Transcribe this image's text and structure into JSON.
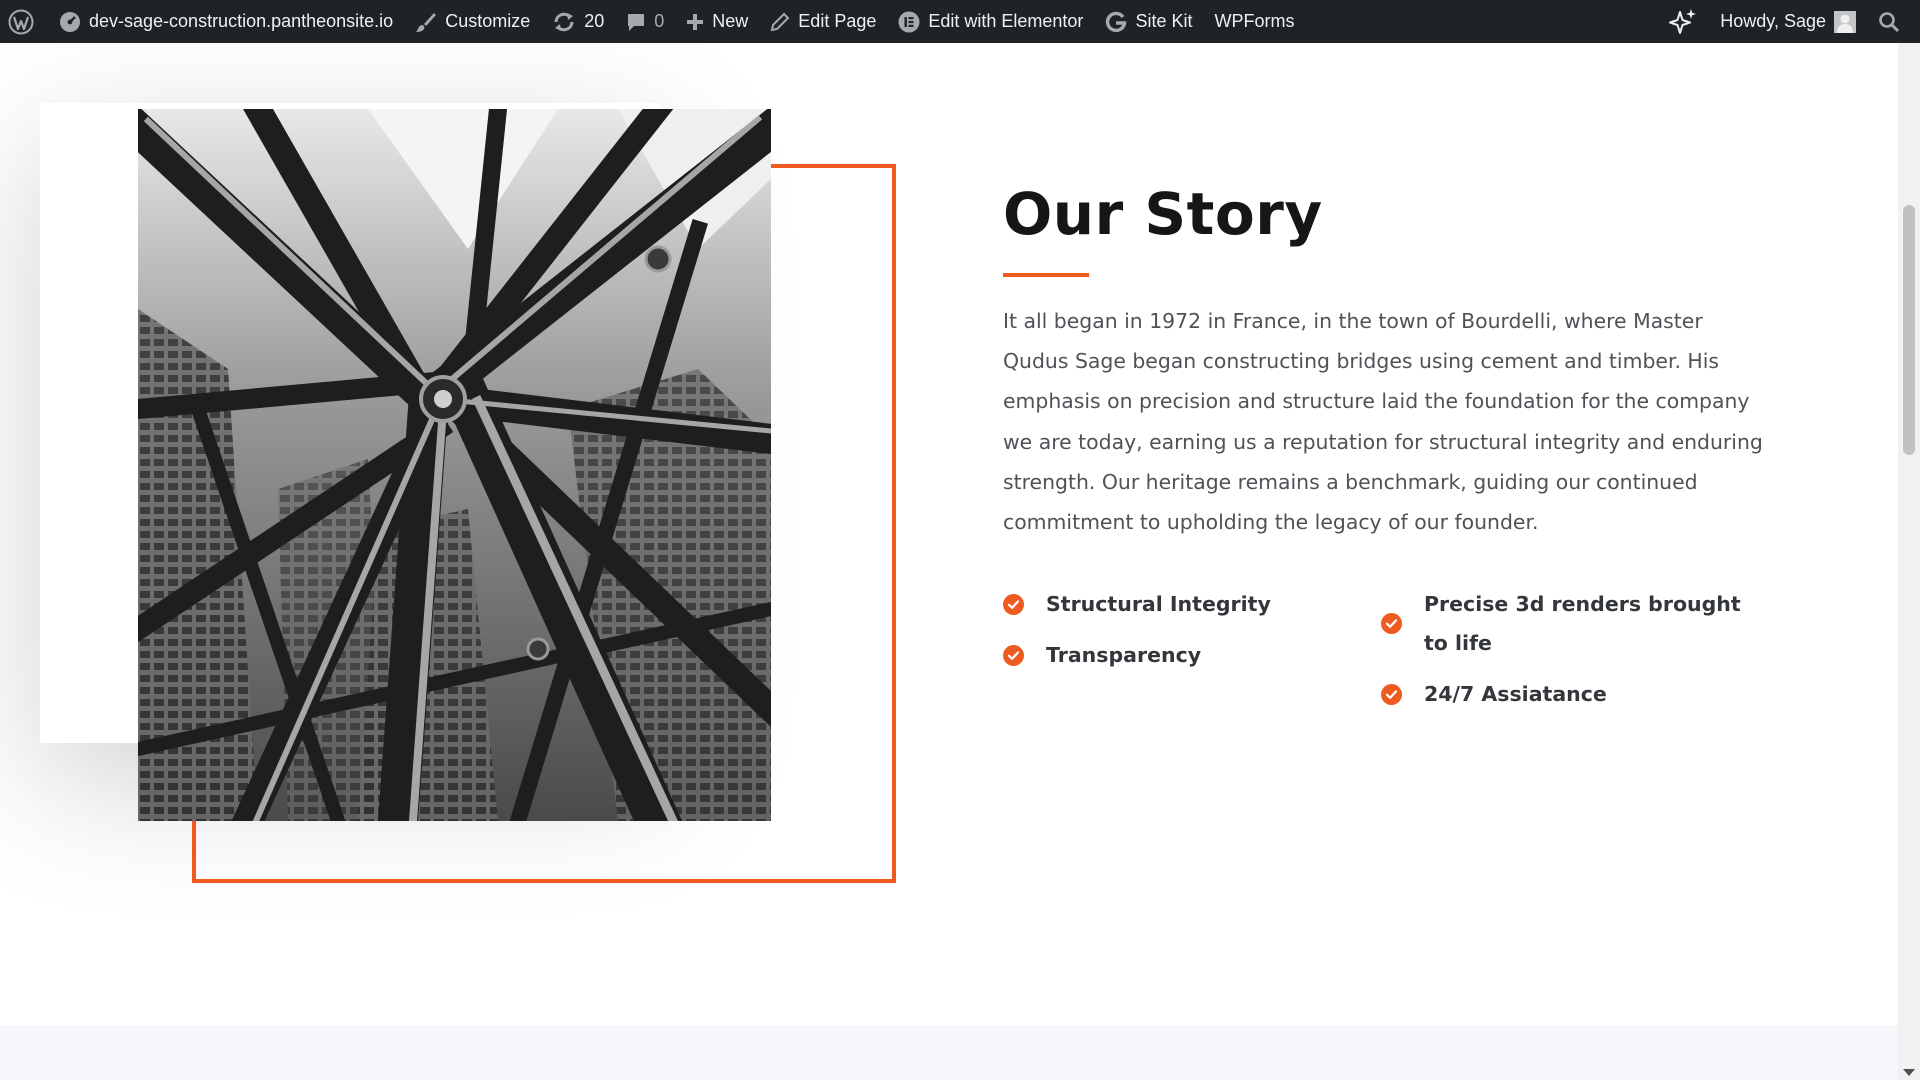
{
  "adminbar": {
    "site": "dev-sage-construction.pantheonsite.io",
    "customize": "Customize",
    "updates_count": "20",
    "comments_count": "0",
    "new": "New",
    "edit_page": "Edit Page",
    "edit_elementor": "Edit with Elementor",
    "site_kit": "Site Kit",
    "wpforms": "WPForms",
    "howdy": "Howdy, Sage",
    "colors": {
      "bar": "#1d2327",
      "text": "#f0f0f1",
      "icon": "#a7aaad"
    }
  },
  "story": {
    "title": "Our Story",
    "body": "It all began in 1972 in France, in the town of Bourdelli, where Master Qudus Sage began constructing bridges using cement and timber. His emphasis on precision and structure laid the foundation for the company we are today, earning us a reputation for structural integrity and enduring strength. Our heritage remains a benchmark, guiding our continued commitment to upholding the legacy of our founder.",
    "features_left": [
      "Structural Integrity",
      "Transparency"
    ],
    "features_right": [
      "Precise 3d renders brought to life",
      "24/7 Assiatance"
    ],
    "accent": "#ee5a1f",
    "icons": {
      "feature": "check-circle-icon"
    }
  }
}
